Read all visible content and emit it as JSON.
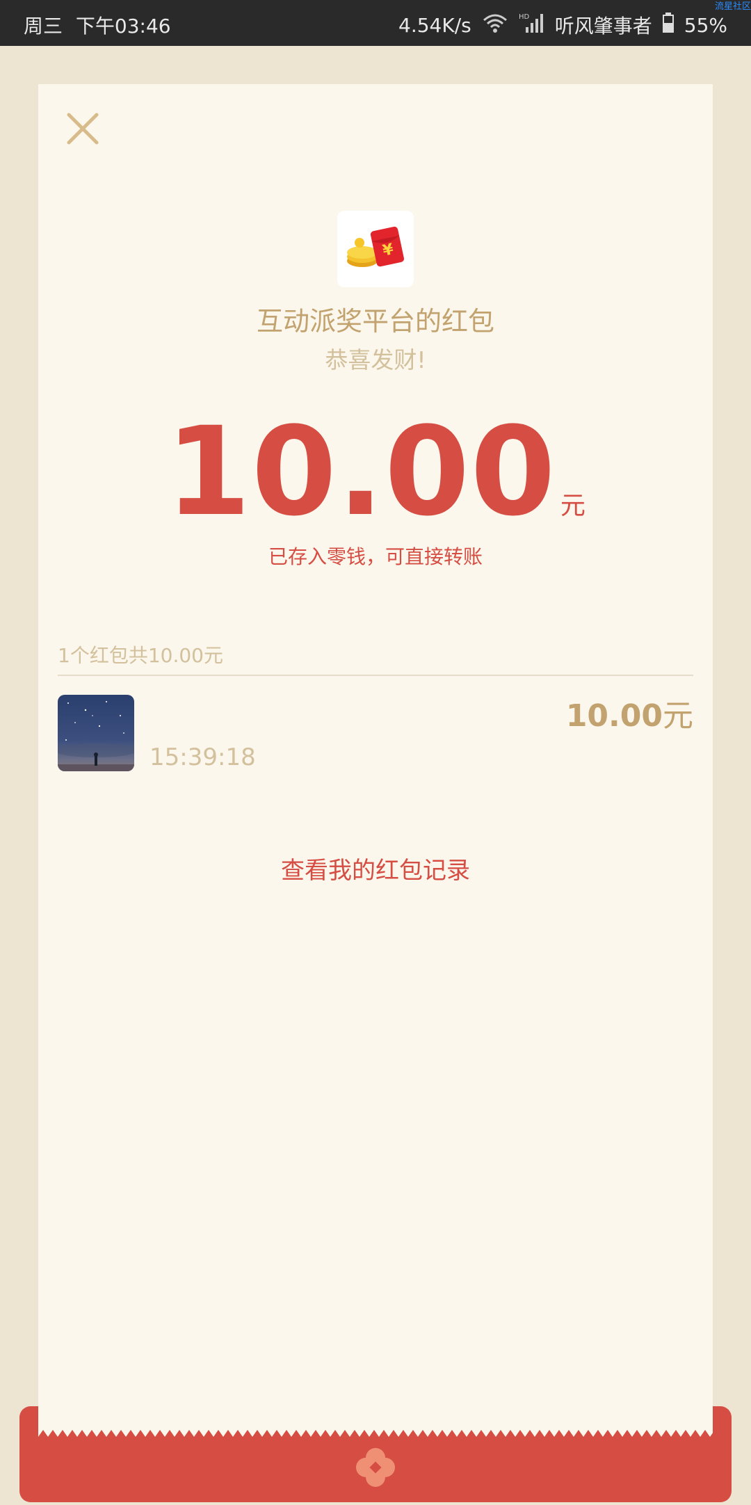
{
  "status_bar": {
    "day": "周三",
    "time": "下午03:46",
    "speed": "4.54K/s",
    "carrier": "听风肇事者",
    "battery": "55%",
    "watermark": "流星社区"
  },
  "packet": {
    "title": "互动派奖平台的红包",
    "greeting": "恭喜发财!",
    "amount": "10.00",
    "unit": "元",
    "saved_note": "已存入零钱，可直接转账",
    "summary": "1个红包共10.00元",
    "records": [
      {
        "time": "15:39:18",
        "amount": "10.00",
        "unit": "元"
      }
    ],
    "view_records": "查看我的红包记录"
  },
  "colors": {
    "accent_red": "#d54d43",
    "gold": "#c2a26e",
    "light_gold": "#d3c09c",
    "card_bg": "#fbf7ec",
    "page_bg": "#ede4d2"
  }
}
